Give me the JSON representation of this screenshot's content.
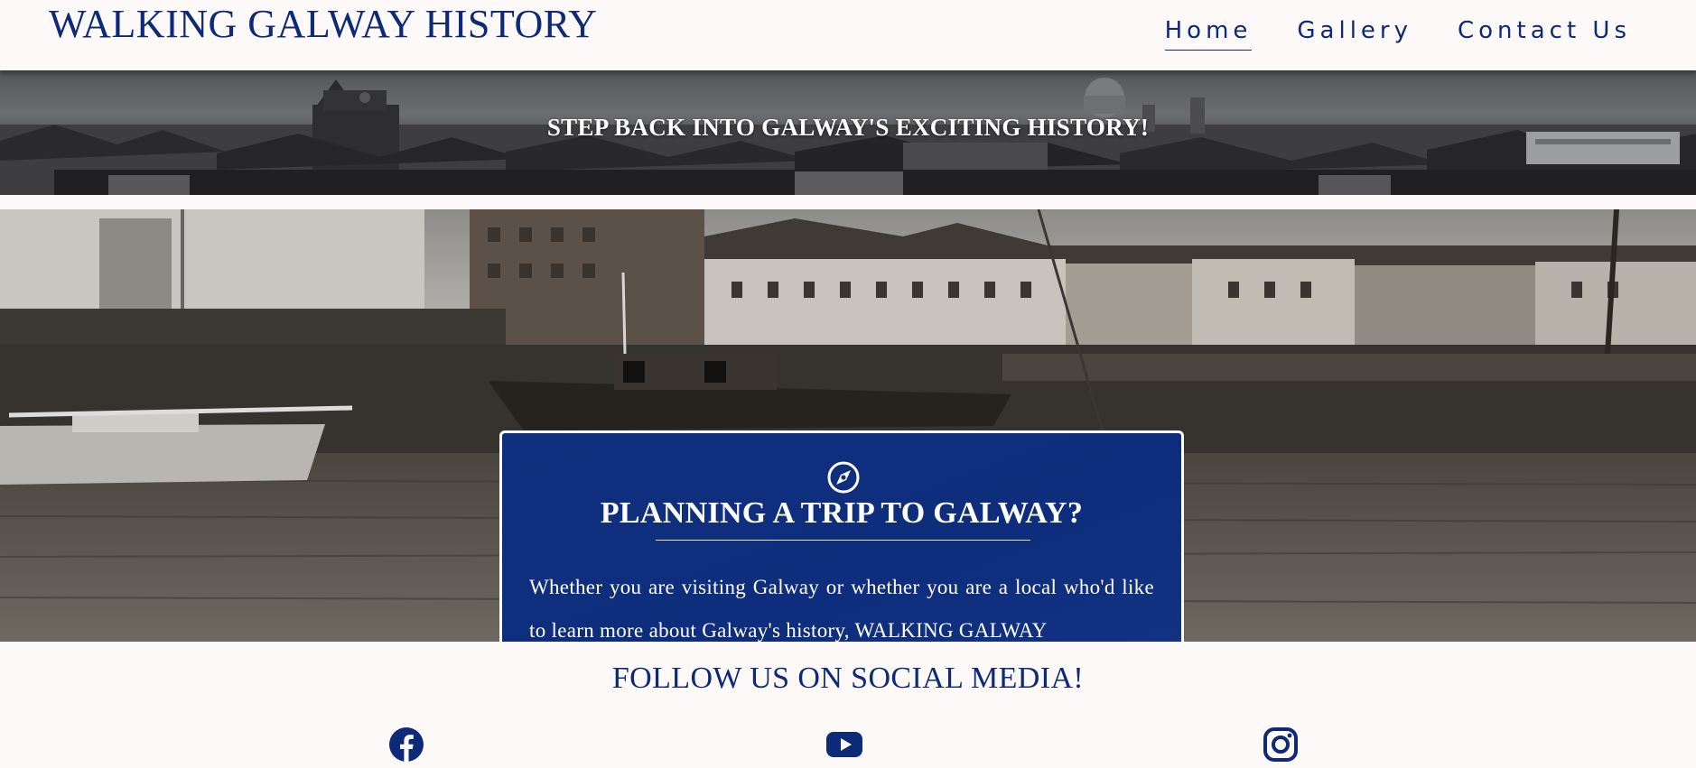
{
  "header": {
    "site_title": "WALKING GALWAY HISTORY",
    "nav": [
      {
        "label": "Home",
        "active": true
      },
      {
        "label": "Gallery",
        "active": false
      },
      {
        "label": "Contact Us",
        "active": false
      }
    ]
  },
  "banner": {
    "heading": "STEP BACK INTO GALWAY'S EXCITING HISTORY!"
  },
  "trip_card": {
    "icon": "compass-icon",
    "heading": "PLANNING A TRIP TO GALWAY?",
    "text": "Whether you are visiting Galway or whether you are a local who'd like to learn more about Galway's history, WALKING GALWAY"
  },
  "social": {
    "heading": "FOLLOW US ON SOCIAL MEDIA!",
    "icons": [
      "facebook-icon",
      "youtube-icon",
      "instagram-icon"
    ]
  },
  "colors": {
    "brand_blue": "#0c2a78",
    "background": "#fcf9f8",
    "card_blue": "#10307f",
    "white": "#ffffff"
  }
}
